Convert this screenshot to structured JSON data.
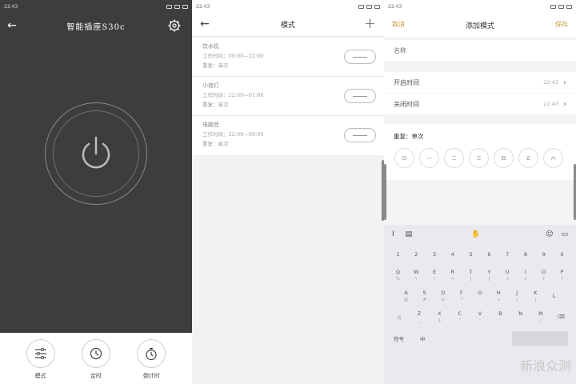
{
  "panel1": {
    "status": {
      "time": "22:43"
    },
    "title": "智能插座S30c",
    "icons": {
      "back": "back-arrow-icon",
      "settings": "gear-icon",
      "power": "power-icon"
    },
    "bottom": [
      {
        "label": "模式",
        "icon": "sliders-icon"
      },
      {
        "label": "定时",
        "icon": "clock-icon"
      },
      {
        "label": "倒计时",
        "icon": "stopwatch-icon"
      }
    ]
  },
  "panel2": {
    "status": {
      "time": "22:43"
    },
    "title": "模式",
    "items": [
      {
        "name": "饮水机",
        "time": "工作时间：09:00—22:00",
        "repeat": "重复：单次"
      },
      {
        "name": "小夜灯",
        "time": "工作时间：22:00—01:00",
        "repeat": "重复：单次"
      },
      {
        "name": "电脑音",
        "time": "工作时间：22:00—08:00",
        "repeat": "重复：单次"
      }
    ]
  },
  "panel3": {
    "status": {
      "time": "22:43"
    },
    "cancel": "取消",
    "title": "添加模式",
    "save": "保存",
    "name_placeholder": "名称",
    "start_label": "开启时间",
    "start_value": "22:43",
    "end_label": "关闭时间",
    "end_value": "22:43",
    "repeat_label": "重复：单次",
    "days": [
      "日",
      "一",
      "二",
      "三",
      "四",
      "五",
      "六"
    ],
    "keyboard": {
      "row_numbers": [
        "1",
        "2",
        "3",
        "4",
        "5",
        "6",
        "7",
        "8",
        "9",
        "0"
      ],
      "row1": [
        {
          "k": "Q",
          "s": "%"
        },
        {
          "k": "W",
          "s": "\\"
        },
        {
          "k": "E",
          "s": "|"
        },
        {
          "k": "R",
          "s": "="
        },
        {
          "k": "T",
          "s": "["
        },
        {
          "k": "Y",
          "s": "]"
        },
        {
          "k": "U",
          "s": "<"
        },
        {
          "k": "I",
          "s": ">"
        },
        {
          "k": "O",
          "s": "{"
        },
        {
          "k": "P",
          "s": "}"
        }
      ],
      "row2": [
        {
          "k": "A",
          "s": "@"
        },
        {
          "k": "S",
          "s": "#"
        },
        {
          "k": "D",
          "s": "&"
        },
        {
          "k": "F",
          "s": "*"
        },
        {
          "k": "G",
          "s": "-"
        },
        {
          "k": "H",
          "s": "+"
        },
        {
          "k": "J",
          "s": "("
        },
        {
          "k": "K",
          "s": ")"
        },
        {
          "k": "L",
          "s": ""
        }
      ],
      "row3": [
        {
          "k": "",
          "s": "词"
        },
        {
          "k": "Z",
          "s": "_"
        },
        {
          "k": "X",
          "s": "$"
        },
        {
          "k": "C",
          "s": "\""
        },
        {
          "k": "V",
          "s": "'"
        },
        {
          "k": "B",
          "s": ":"
        },
        {
          "k": "N",
          "s": ";"
        },
        {
          "k": "M",
          "s": "/"
        },
        {
          "k": "⌫",
          "s": ""
        }
      ],
      "bottom_left": "符号",
      "bottom_mid": "中"
    },
    "watermark": "新浪众测"
  }
}
